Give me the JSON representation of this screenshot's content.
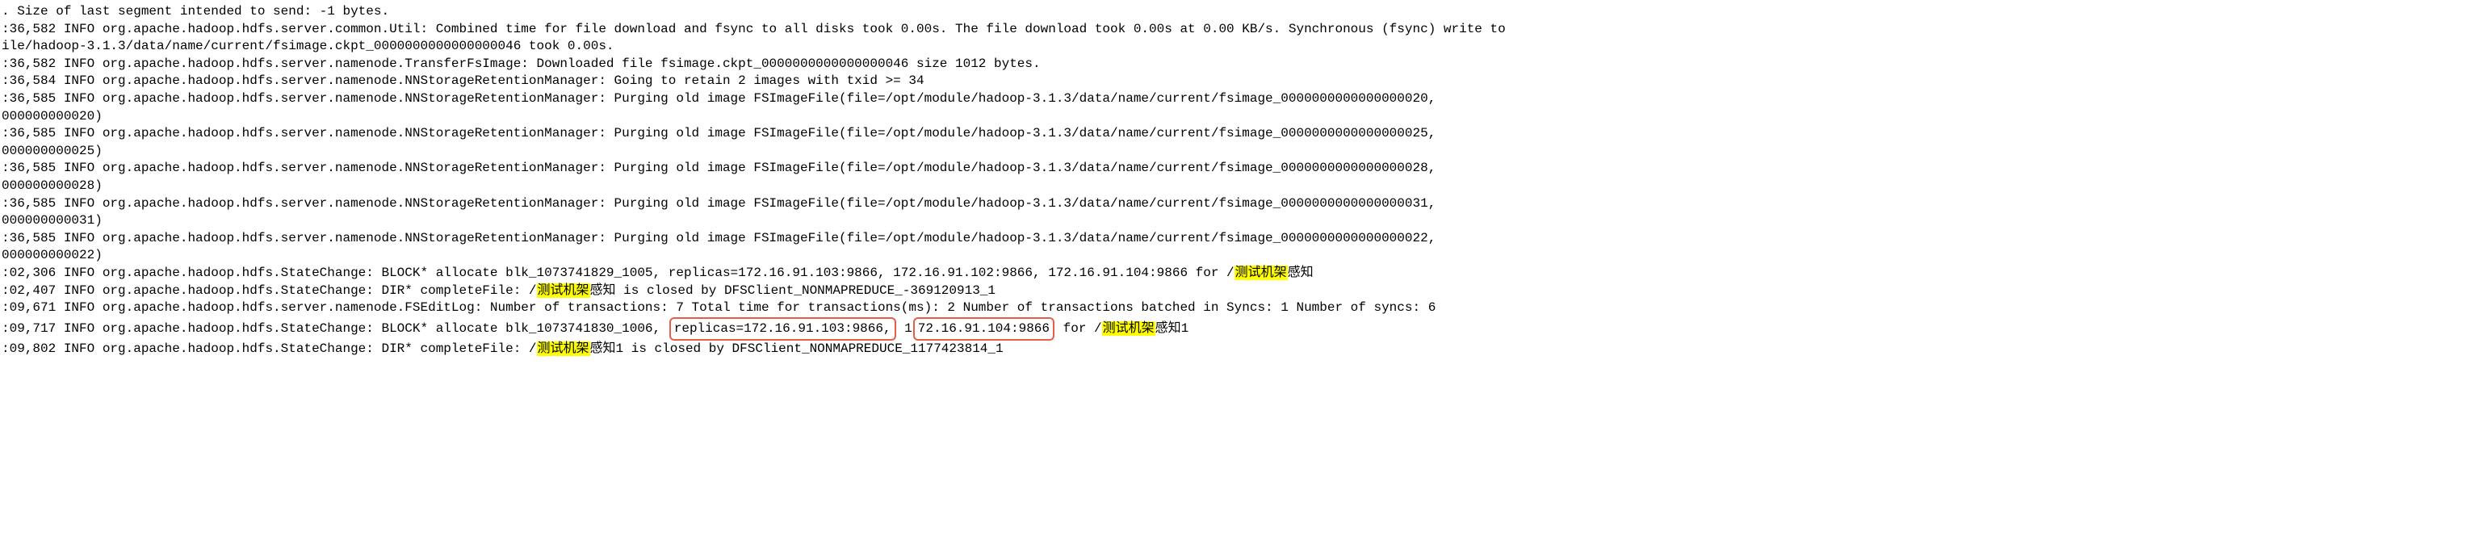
{
  "lines": {
    "l0_a": ". Size of last segment intended to send: -1 bytes.",
    "l1": ":36,582 INFO org.apache.hadoop.hdfs.server.common.Util: Combined time for file download and fsync to all disks took 0.00s. The file download took 0.00s at 0.00 KB/s. Synchronous (fsync) write to",
    "l2": "ile/hadoop-3.1.3/data/name/current/fsimage.ckpt_0000000000000000046 took 0.00s.",
    "l3": ":36,582 INFO org.apache.hadoop.hdfs.server.namenode.TransferFsImage: Downloaded file fsimage.ckpt_0000000000000000046 size 1012 bytes.",
    "l4": ":36,584 INFO org.apache.hadoop.hdfs.server.namenode.NNStorageRetentionManager: Going to retain 2 images with txid >= 34",
    "l5": ":36,585 INFO org.apache.hadoop.hdfs.server.namenode.NNStorageRetentionManager: Purging old image FSImageFile(file=/opt/module/hadoop-3.1.3/data/name/current/fsimage_0000000000000000020,",
    "l6": "000000000020)",
    "l7": ":36,585 INFO org.apache.hadoop.hdfs.server.namenode.NNStorageRetentionManager: Purging old image FSImageFile(file=/opt/module/hadoop-3.1.3/data/name/current/fsimage_0000000000000000025,",
    "l8": "000000000025)",
    "l9": ":36,585 INFO org.apache.hadoop.hdfs.server.namenode.NNStorageRetentionManager: Purging old image FSImageFile(file=/opt/module/hadoop-3.1.3/data/name/current/fsimage_0000000000000000028,",
    "l10": "000000000028)",
    "l11": ":36,585 INFO org.apache.hadoop.hdfs.server.namenode.NNStorageRetentionManager: Purging old image FSImageFile(file=/opt/module/hadoop-3.1.3/data/name/current/fsimage_0000000000000000031,",
    "l12": "000000000031)",
    "l13": ":36,585 INFO org.apache.hadoop.hdfs.server.namenode.NNStorageRetentionManager: Purging old image FSImageFile(file=/opt/module/hadoop-3.1.3/data/name/current/fsimage_0000000000000000022,",
    "l14": "000000000022)",
    "l15_a": ":02,306 INFO org.apache.hadoop.hdfs.StateChange: BLOCK* allocate blk_1073741829_1005, replicas=172.16.91.103:9866, 172.16.91.102:9866, 172.16.91.104:9866 for /",
    "l15_hl": "测试机架",
    "l15_b": "感知",
    "l16_a": ":02,407 INFO org.apache.hadoop.hdfs.StateChange: DIR* completeFile: /",
    "l16_hl": "测试机架",
    "l16_b": "感知 is closed by DFSClient_NONMAPREDUCE_-369120913_1",
    "l17": ":09,671 INFO org.apache.hadoop.hdfs.server.namenode.FSEditLog: Number of transactions: 7 Total time for transactions(ms): 2 Number of transactions batched in Syncs: 1 Number of syncs: 6",
    "l18": " ",
    "l19_a": ":09,717 INFO org.apache.hadoop.hdfs.StateChange: BLOCK* allocate blk_1073741830_1006, ",
    "l19_box1": "replicas=172.16.91.103:9866,",
    "l19_mid": " 1",
    "l19_box2": "72.16.91.104:9866",
    "l19_b": " for /",
    "l19_hl": "测试机架",
    "l19_c": "感知1",
    "l20_a": ":09,802 INFO org.apache.hadoop.hdfs.StateChange: DIR* completeFile: /",
    "l20_hl": "测试机架",
    "l20_b": "感知1 is closed by DFSClient_NONMAPREDUCE_1177423814_1"
  }
}
